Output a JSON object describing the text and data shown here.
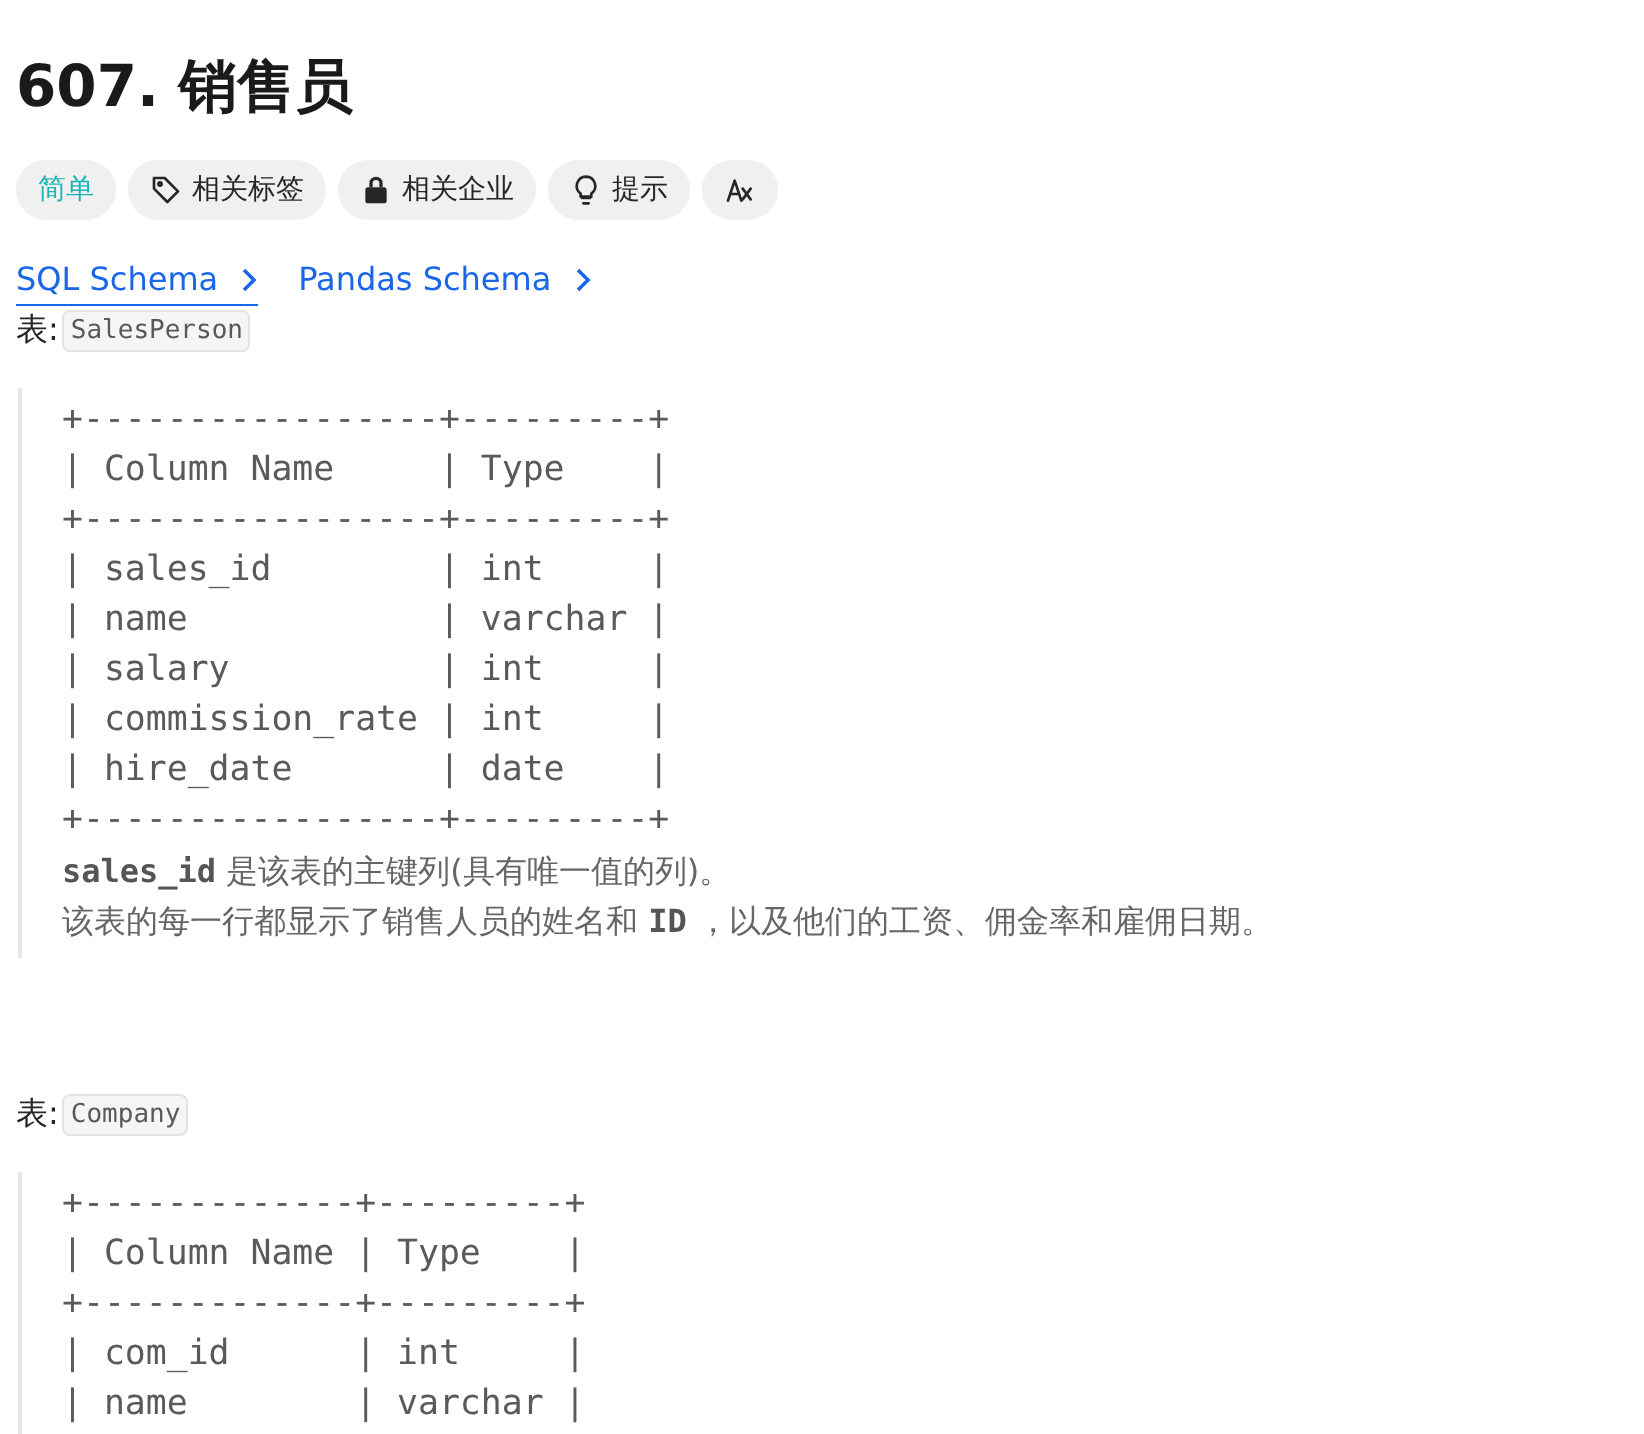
{
  "title": "607. 销售员",
  "tags": [
    {
      "kind": "difficulty",
      "label": "简单"
    },
    {
      "kind": "tag",
      "label": "相关标签"
    },
    {
      "kind": "lock",
      "label": "相关企业"
    },
    {
      "kind": "hint",
      "label": "提示"
    },
    {
      "kind": "translate"
    }
  ],
  "schema_tabs": [
    {
      "label": "SQL Schema",
      "selected": true
    },
    {
      "label": "Pandas Schema",
      "selected": false
    }
  ],
  "tables": [
    {
      "label": "表:",
      "name": "SalesPerson",
      "lines": [
        "+-----------------+---------+",
        "| Column Name     | Type    |",
        "+-----------------+---------+",
        "| sales_id        | int     |",
        "| name            | varchar |",
        "| salary          | int     |",
        "| commission_rate | int     |",
        "| hire_date       | date    |",
        "+-----------------+---------+"
      ],
      "notes": [
        "**sales_id** 是该表的主键列(具有唯一值的列)。",
        "该表的每一行都显示了销售人员的姓名和 **ID** ，以及他们的工资、佣金率和雇佣日期。"
      ]
    },
    {
      "label": "表:",
      "name": "Company",
      "lines": [
        "+-------------+---------+",
        "| Column Name | Type    |",
        "+-------------+---------+",
        "| com_id      | int     |",
        "| name        | varchar |"
      ]
    }
  ]
}
